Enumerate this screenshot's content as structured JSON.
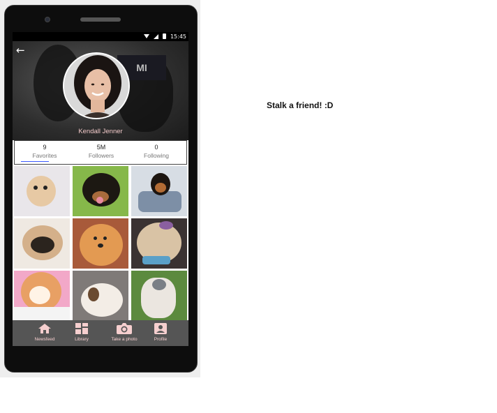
{
  "caption": "Stalk a friend! :D",
  "status": {
    "time": "15:45"
  },
  "profile": {
    "name": "Kendall Jenner",
    "banner_text": "MI"
  },
  "stats": [
    {
      "value": "9",
      "label": "Favorites"
    },
    {
      "value": "5M",
      "label": "Followers"
    },
    {
      "value": "0",
      "label": "Following"
    }
  ],
  "nav": [
    {
      "label": "Newsfeed",
      "icon": "home-icon"
    },
    {
      "label": "Library",
      "icon": "grid-icon"
    },
    {
      "label": "Take a photo",
      "icon": "camera-icon"
    },
    {
      "label": "Profile",
      "icon": "profile-icon"
    }
  ],
  "colors": {
    "accent": "#3d5afe",
    "nav_bg": "#555555",
    "nav_text": "#f6cfcf",
    "name_text": "#f1c9c9"
  }
}
